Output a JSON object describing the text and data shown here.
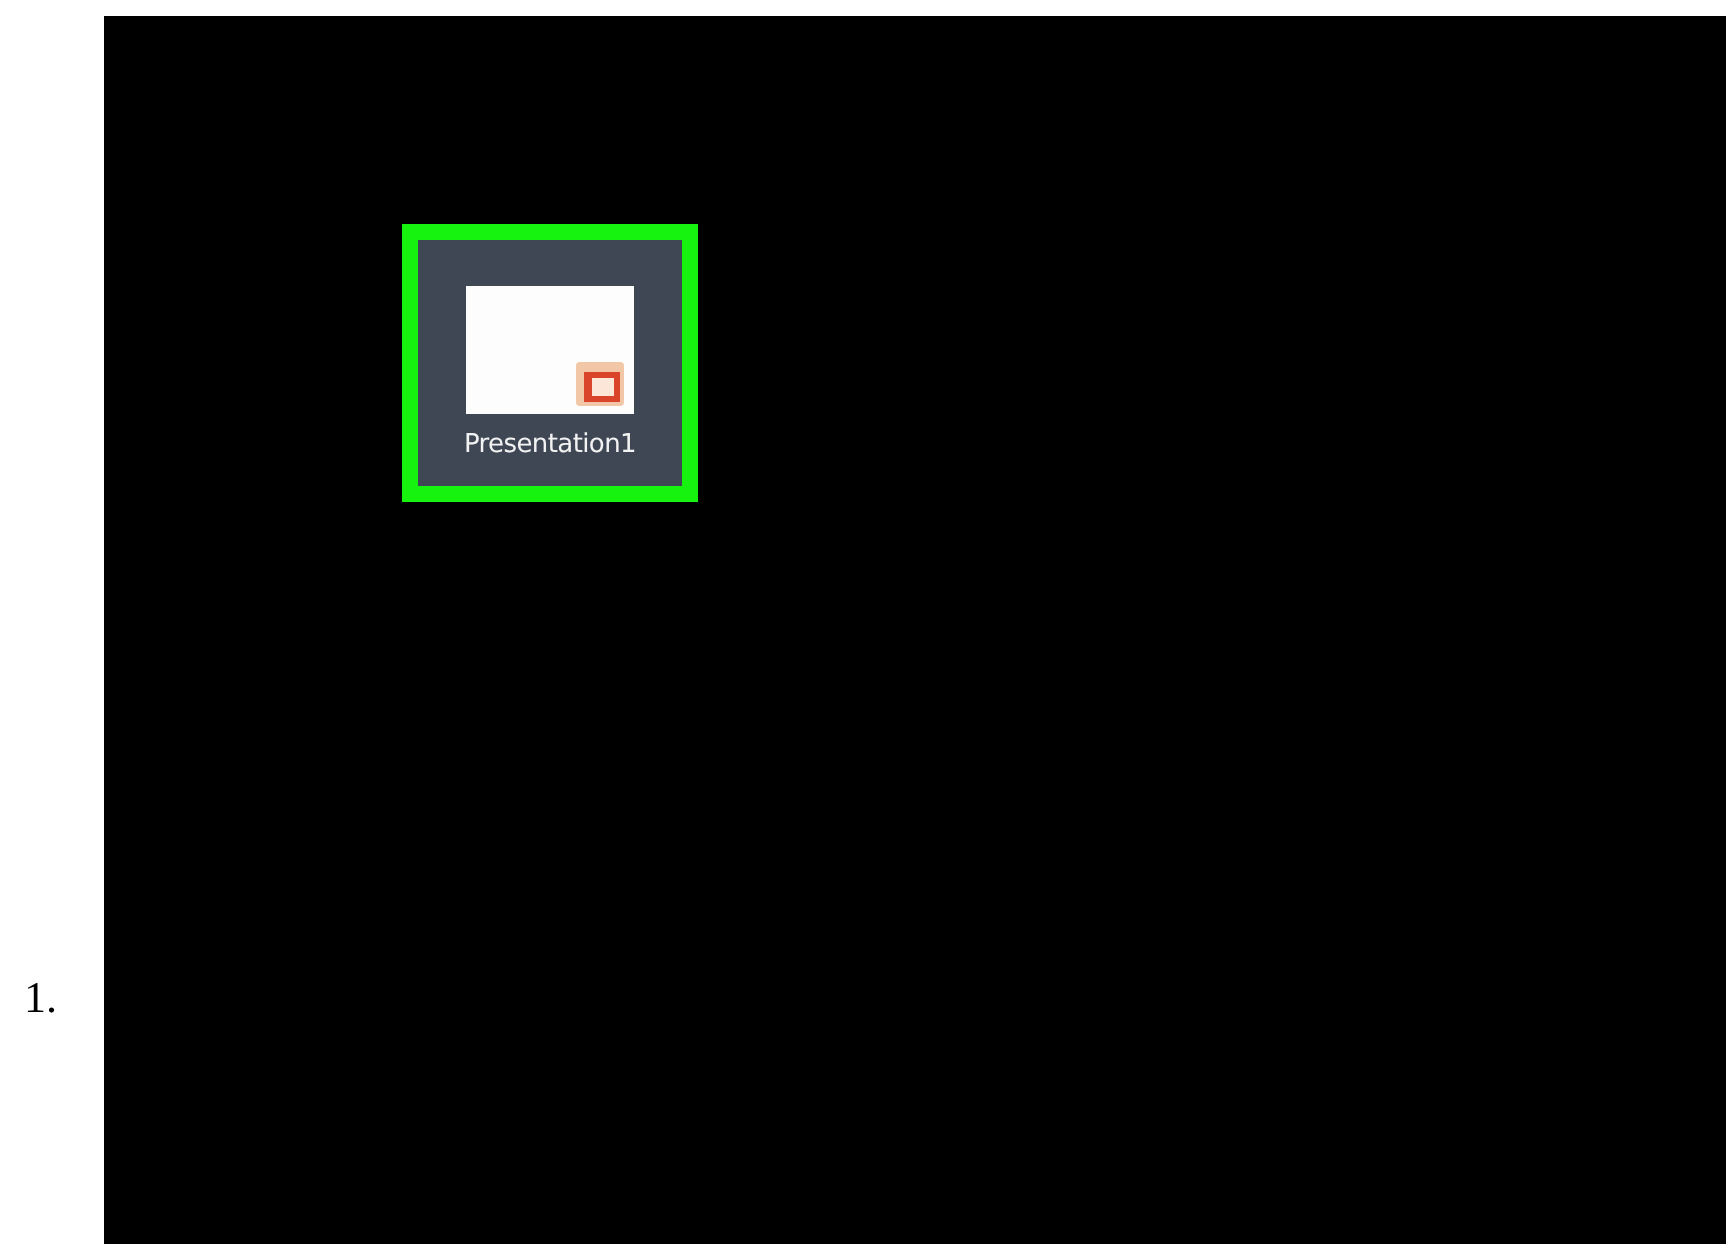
{
  "step": {
    "number": "1."
  },
  "desktop": {
    "icons": [
      {
        "label": "Presentation1",
        "selected": true,
        "highlighted": true
      }
    ]
  }
}
